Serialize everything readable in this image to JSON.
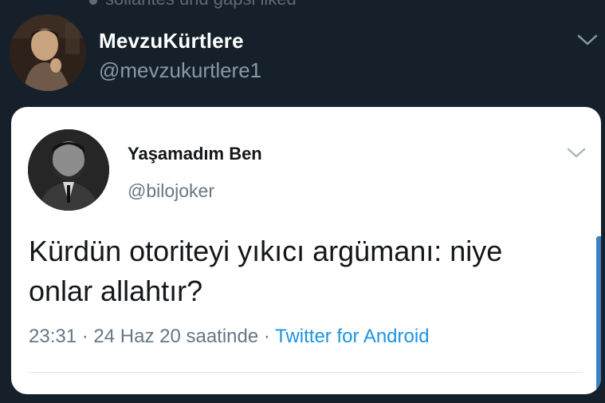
{
  "outer_tweet": {
    "context_text": "sollantes und gapsi liked",
    "user": {
      "name": "MevzuKürtlere",
      "handle": "@mevzukurtlere1"
    },
    "chevron_icon": "chevron-down-icon"
  },
  "quoted_tweet": {
    "user": {
      "name": "Yaşamadım Ben",
      "handle": "@bilojoker"
    },
    "text_line1": "Kürdün otoriteyi yıkıcı argümanı: niye",
    "text_line2": "onlar allahtır?",
    "time": "23:31",
    "date": "24 Haz 20 saatinde",
    "separator": "·",
    "source": "Twitter for Android",
    "chevron_icon": "chevron-down-icon"
  },
  "colors": {
    "background": "#15202b",
    "card": "#ffffff",
    "link": "#1b95e0",
    "muted": "#8899a6"
  }
}
